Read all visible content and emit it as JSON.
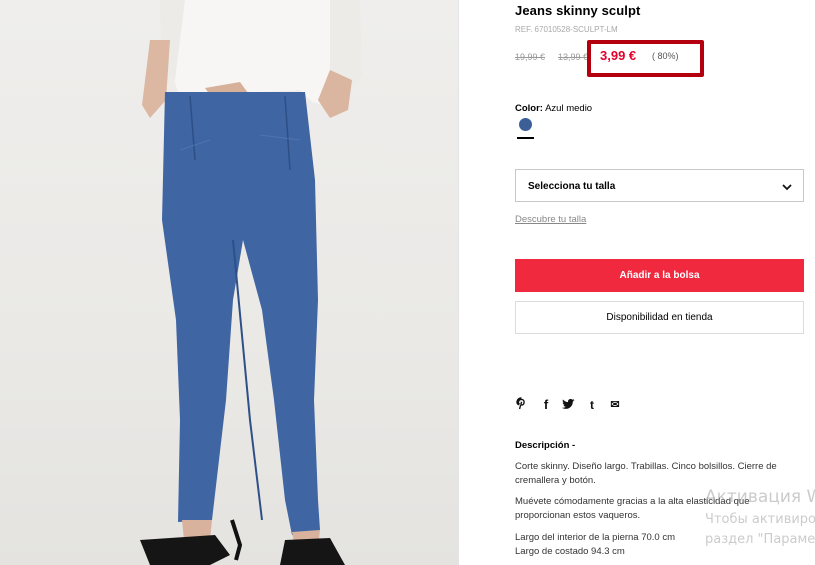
{
  "product": {
    "title": "Jeans skinny sculpt",
    "ref": "REF. 67010528-SCULPT-LM"
  },
  "price": {
    "old_1": "19,99 €",
    "old_2": "13,99 €",
    "sale": "3,99 €",
    "discount": "( 80%)",
    "highlight_color": "#b4000e",
    "sale_color": "#e4002b"
  },
  "color": {
    "label": "Color:",
    "value": "Azul medio",
    "swatch_hex": "#3c5f97"
  },
  "size_select": {
    "label": "Selecciona tu talla",
    "icon": "chevron-down-icon"
  },
  "size_link": "Descubre tu talla",
  "buttons": {
    "add_to_bag": "Añadir a la bolsa",
    "add_color": "#f0293f",
    "store_availability": "Disponibilidad en tienda"
  },
  "social_icons": [
    "pinterest-icon",
    "facebook-icon",
    "twitter-icon",
    "tumblr-icon",
    "email-icon"
  ],
  "social_glyphs": {
    "pinterest": "𝓅",
    "facebook": "f",
    "twitter": "🐦",
    "tumblr": "t",
    "email": "✉"
  },
  "description": {
    "title": "Descripción -",
    "p1": "Corte skinny. Diseño largo. Trabillas. Cinco bolsillos. Cierre de cremallera y botón.",
    "p2": "Muévete cómodamente gracias a la alta elasticidad que proporcionan estos vaqueros.",
    "p3_line1": "Largo del interior de la pierna 70.0 cm",
    "p3_line2": "Largo de costado 94.3 cm"
  },
  "watermark": {
    "line1": "Активация W",
    "line2": "Чтобы активиро",
    "line3": "раздел \"Параме"
  }
}
